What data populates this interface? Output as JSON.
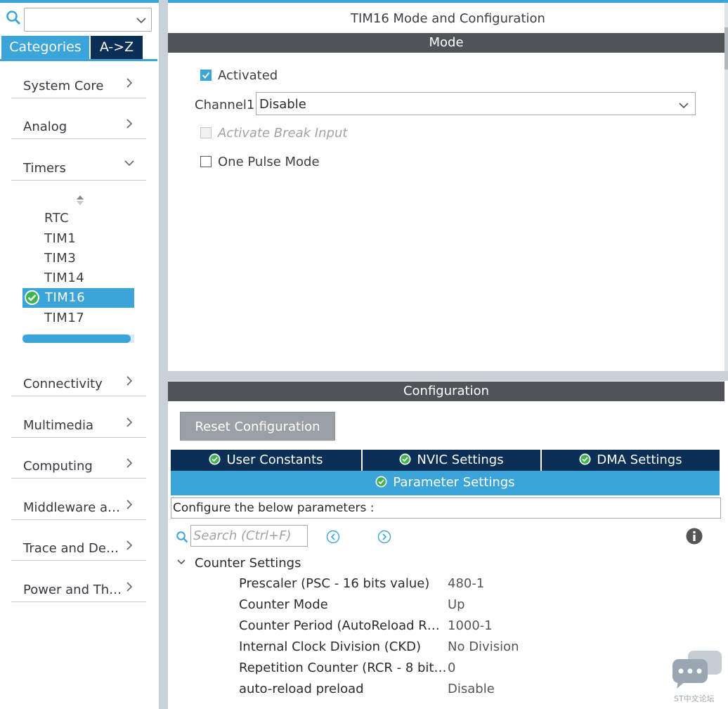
{
  "left_panel": {
    "search": {
      "value": ""
    },
    "tabs": {
      "categories": "Categories",
      "az": "A->Z"
    },
    "categories": [
      {
        "label": "System Core"
      },
      {
        "label": "Analog"
      },
      {
        "label": "Timers"
      },
      {
        "label": "Connectivity"
      },
      {
        "label": "Multimedia"
      },
      {
        "label": "Computing"
      },
      {
        "label": "Middleware a…"
      },
      {
        "label": "Trace and De…"
      },
      {
        "label": "Power and Th…"
      }
    ],
    "timers": [
      "RTC",
      "TIM1",
      "TIM3",
      "TIM14",
      "TIM16",
      "TIM17"
    ],
    "selected_timer": "TIM16"
  },
  "main": {
    "title": "TIM16 Mode and Configuration",
    "mode_header": "Mode",
    "activated_label": "Activated",
    "channel1_label": "Channel1",
    "channel1_value": "Disable",
    "break_input_label": "Activate Break Input",
    "one_pulse_label": "One Pulse Mode",
    "config_header": "Configuration",
    "reset_button": "Reset Configuration",
    "tabs": [
      {
        "label": "User Constants"
      },
      {
        "label": "NVIC Settings"
      },
      {
        "label": "DMA Settings"
      }
    ],
    "active_tab": "Parameter Settings",
    "hint": "Configure the below parameters :",
    "search_placeholder": "Search (Ctrl+F)",
    "group": "Counter Settings",
    "params": [
      {
        "key": "Prescaler (PSC - 16 bits value)",
        "value": "480-1"
      },
      {
        "key": "Counter Mode",
        "value": "Up"
      },
      {
        "key": "Counter Period (AutoReload R…",
        "value": "1000-1"
      },
      {
        "key": "Internal Clock Division (CKD)",
        "value": "No Division"
      },
      {
        "key": "Repetition Counter (RCR - 8 bit…",
        "value": "0"
      },
      {
        "key": "auto-reload preload",
        "value": "Disable"
      }
    ]
  },
  "watermark": "ST中文论坛",
  "colors": {
    "accent": "#3ba4d8",
    "navy": "#0b2f55",
    "band": "#505458"
  }
}
